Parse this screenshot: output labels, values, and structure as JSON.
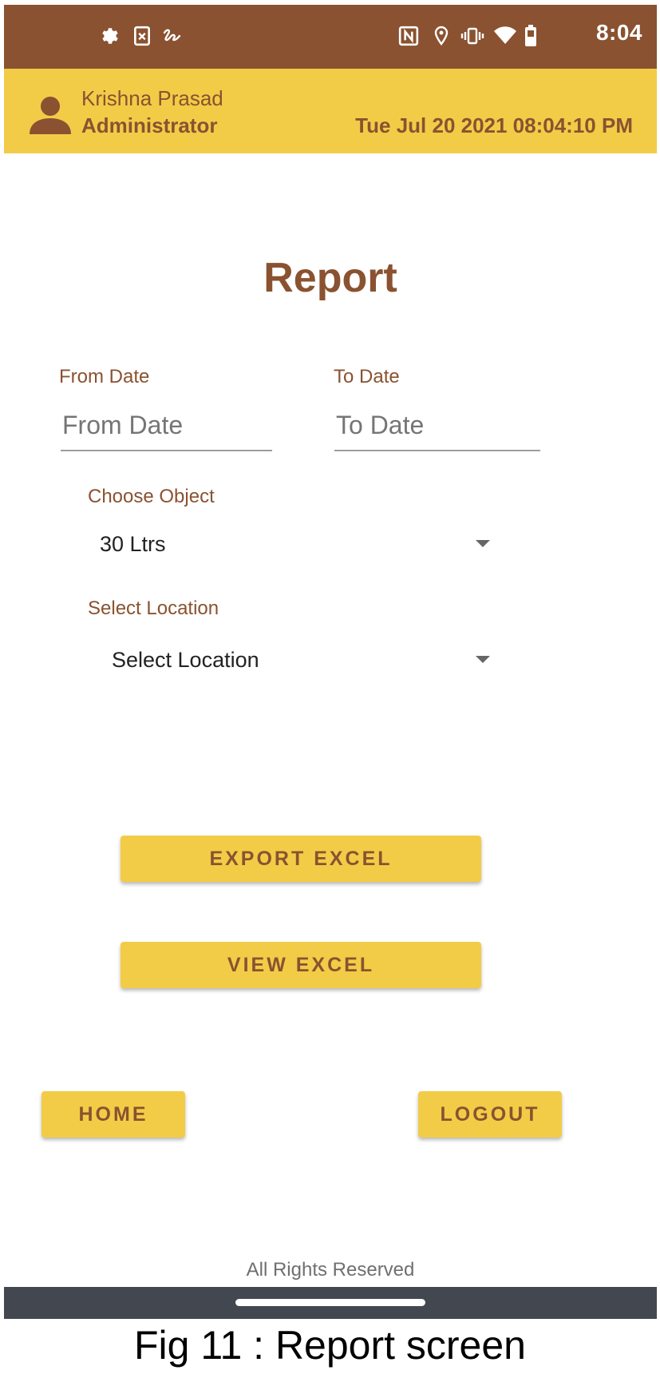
{
  "status_bar": {
    "time": "8:04",
    "left_icons": [
      "settings-icon",
      "sim-card-icon",
      "signature-icon"
    ],
    "right_icons": [
      "nfc-icon",
      "location-icon",
      "vibrate-icon",
      "wifi-icon",
      "battery-icon"
    ]
  },
  "header": {
    "user_name": "Krishna Prasad",
    "user_role": "Administrator",
    "datetime": "Tue Jul 20 2021 08:04:10 PM"
  },
  "page": {
    "title": "Report",
    "from_date_label": "From Date",
    "from_date_placeholder": "From Date",
    "to_date_label": "To Date",
    "to_date_placeholder": "To Date",
    "object_label": "Choose Object",
    "object_value": "30 Ltrs",
    "location_label": "Select Location",
    "location_value": "Select Location"
  },
  "buttons": {
    "export_excel": "EXPORT EXCEL",
    "view_excel": "VIEW EXCEL",
    "home": "HOME",
    "logout": "LOGOUT"
  },
  "footer": {
    "text": "All Rights Reserved"
  },
  "caption": "Fig 11 : Report screen",
  "colors": {
    "status_bar": "#8a5230",
    "header": "#f2cc47",
    "accent_brown": "#8a5230",
    "button": "#f2cc47",
    "nav_bar": "#434750"
  }
}
